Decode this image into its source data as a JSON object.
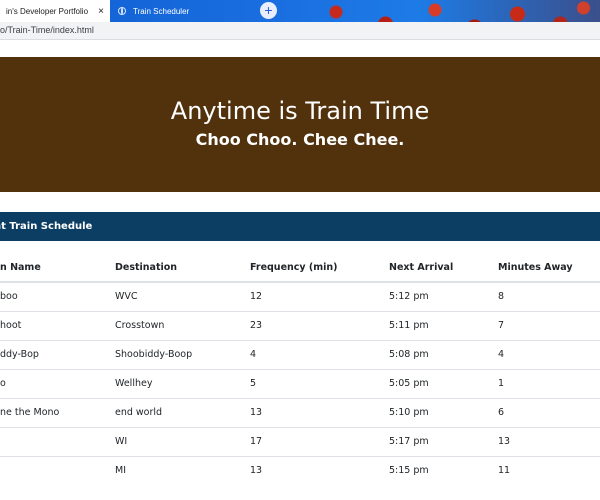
{
  "browser": {
    "active_tab": "in's Developer Portfolio",
    "inactive_tab": "Train Scheduler",
    "close_glyph": "×",
    "new_tab_glyph": "+",
    "url": "o/Train-Time/index.html"
  },
  "hero": {
    "title": "Anytime is Train Time",
    "subtitle": "Choo Choo. Chee Chee."
  },
  "card": {
    "header": "nt Train Schedule"
  },
  "table": {
    "columns": [
      "n Name",
      "Destination",
      "Frequency (min)",
      "Next Arrival",
      "Minutes Away"
    ],
    "rows": [
      [
        "boo",
        "WVC",
        "12",
        "5:12 pm",
        "8"
      ],
      [
        "hoot",
        "Crosstown",
        "23",
        "5:11 pm",
        "7"
      ],
      [
        "ddy-Bop",
        "Shoobiddy-Boop",
        "4",
        "5:08 pm",
        "4"
      ],
      [
        "o",
        "Wellhey",
        "5",
        "5:05 pm",
        "1"
      ],
      [
        "ne the Mono",
        "end world",
        "13",
        "5:10 pm",
        "6"
      ],
      [
        "",
        "WI",
        "17",
        "5:17 pm",
        "13"
      ],
      [
        "",
        "MI",
        "13",
        "5:15 pm",
        "11"
      ]
    ]
  }
}
